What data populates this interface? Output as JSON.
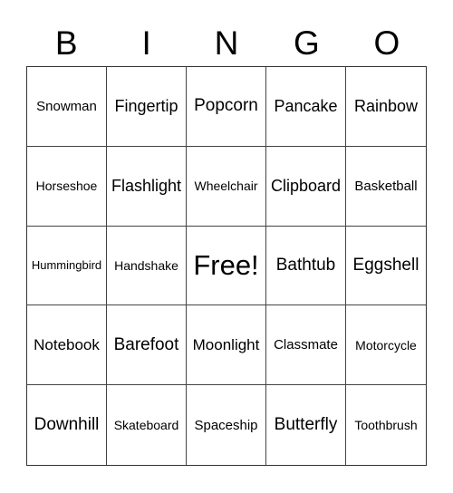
{
  "header": {
    "letters": [
      "B",
      "I",
      "N",
      "G",
      "O"
    ]
  },
  "cells": [
    "Snowman",
    "Fingertip",
    "Popcorn",
    "Pancake",
    "Rainbow",
    "Horseshoe",
    "Flashlight",
    "Wheelchair",
    "Clipboard",
    "Basketball",
    "Hummingbird",
    "Handshake",
    "Free!",
    "Bathtub",
    "Eggshell",
    "Notebook",
    "Barefoot",
    "Moonlight",
    "Classmate",
    "Motorcycle",
    "Downhill",
    "Skateboard",
    "Spaceship",
    "Butterfly",
    "Toothbrush"
  ]
}
